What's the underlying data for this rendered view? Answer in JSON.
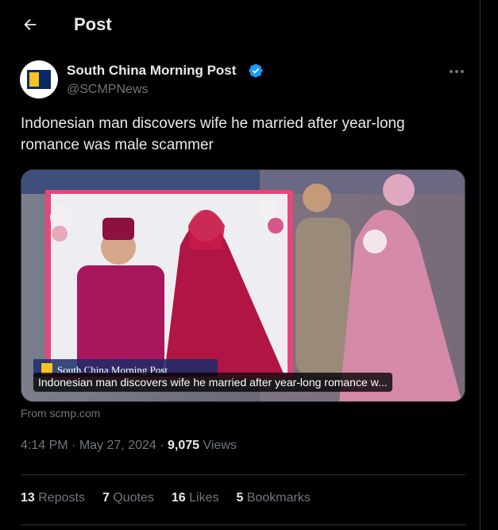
{
  "header": {
    "title": "Post",
    "back_icon": "arrow-left-icon"
  },
  "author": {
    "name": "South China Morning Post",
    "handle": "@SCMPNews",
    "verified_icon": "verified-badge-icon",
    "verified_color": "#1d9bf0",
    "more_icon": "more-horizontal-icon"
  },
  "tweet": {
    "text": "Indonesian man discovers wife he married after year-long romance was male scammer"
  },
  "media": {
    "caption": "Indonesian man discovers wife he married after year-long romance w...",
    "watermark": "South China Morning Post",
    "source_label": "From scmp.com"
  },
  "meta": {
    "time": "4:14 PM",
    "separator": " · ",
    "date": "May 27, 2024",
    "views_count": "9,075",
    "views_label": " Views"
  },
  "stats": [
    {
      "count": "13",
      "label": " Reposts"
    },
    {
      "count": "7",
      "label": " Quotes"
    },
    {
      "count": "16",
      "label": " Likes"
    },
    {
      "count": "5",
      "label": " Bookmarks"
    }
  ],
  "colors": {
    "background": "#000000",
    "text_primary": "#e7e9ea",
    "text_secondary": "#71767b",
    "border": "#2f3336",
    "accent": "#1d9bf0"
  }
}
